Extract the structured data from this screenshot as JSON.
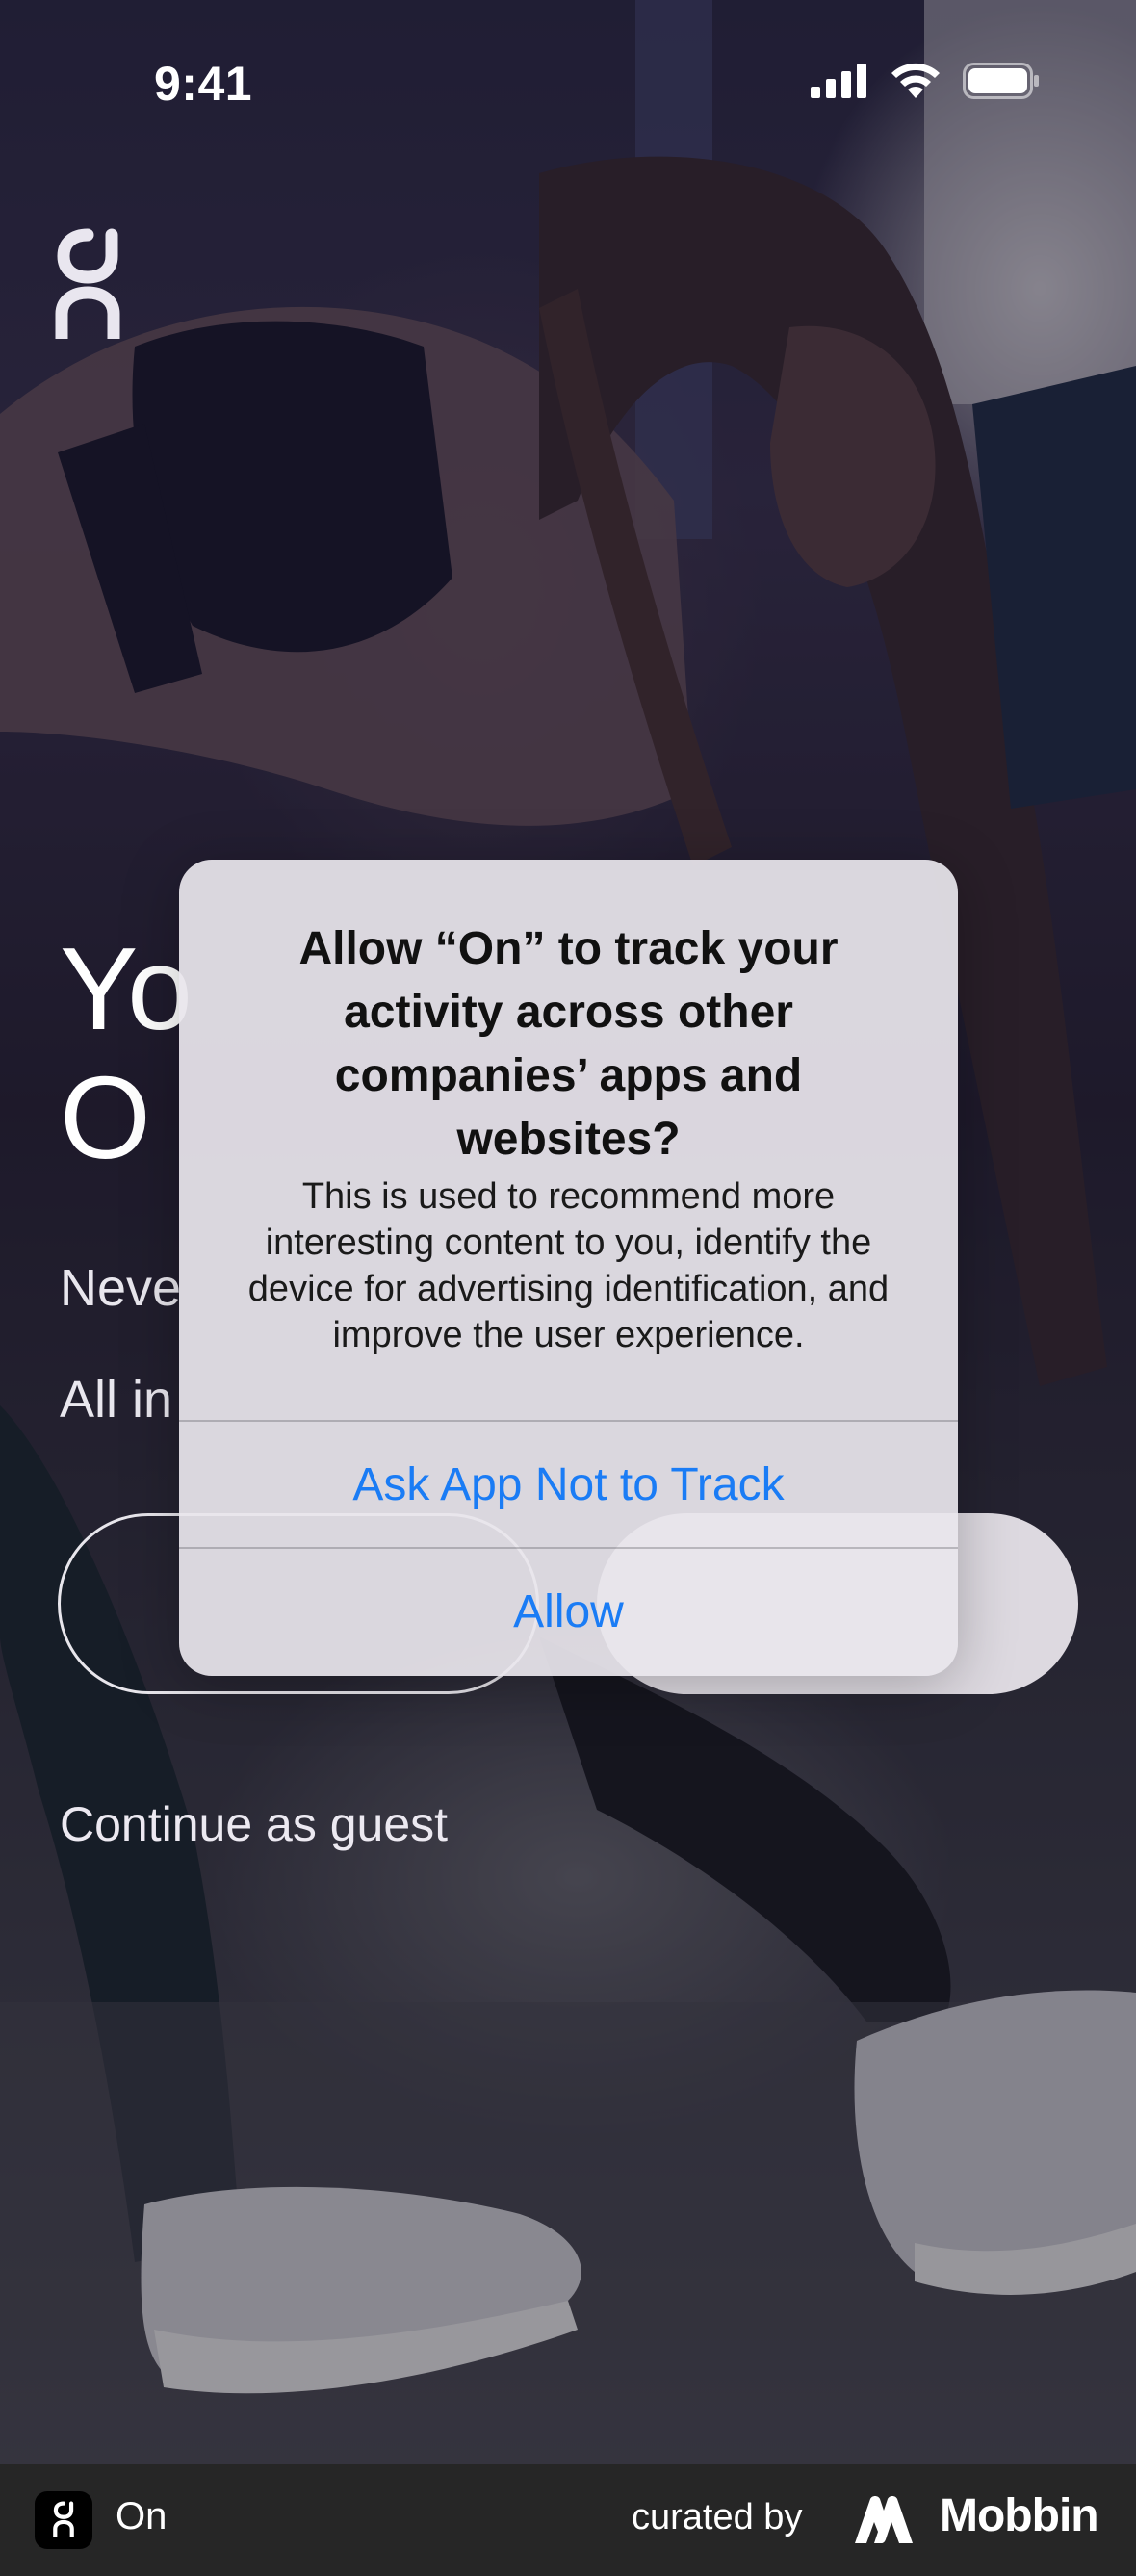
{
  "status_bar": {
    "time": "9:41",
    "icons": [
      "cellular-signal-icon",
      "wifi-icon",
      "battery-icon"
    ]
  },
  "brand": {
    "logo_icon": "on-logo-icon"
  },
  "background_screen": {
    "headline_partial": "Yo\nO",
    "subtitle_partial": "Neve\nAll in",
    "continue_guest": "Continue as guest"
  },
  "alert": {
    "title": "Allow “On” to track your activity across other companies’ apps and websites?",
    "message": "This is used to recommend more interesting content to you, identify the device for advertising identification, and improve the user experience.",
    "actions": [
      {
        "label": "Ask App Not to Track"
      },
      {
        "label": "Allow"
      }
    ],
    "action_color": "#1a7cf5"
  },
  "footer": {
    "app_name": "On",
    "curated_by": "curated by",
    "brand": "Mobbin"
  }
}
